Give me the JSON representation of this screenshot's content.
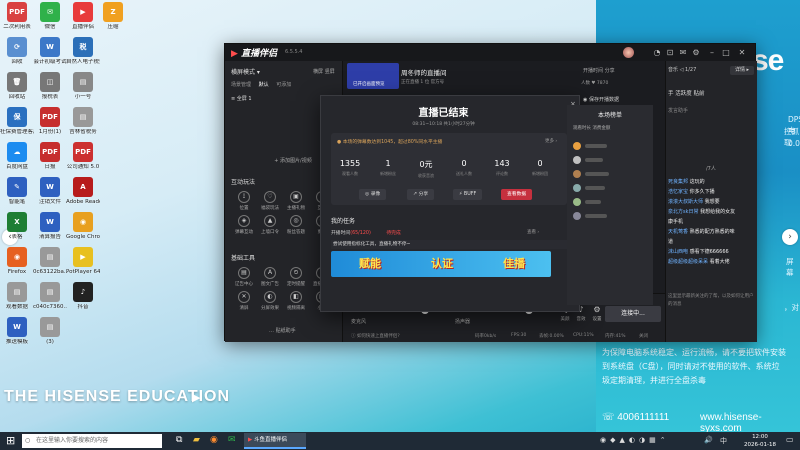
{
  "desktop": {
    "icons": [
      {
        "label": "二次利用表",
        "color": "#d94141",
        "glyph": "PDF"
      },
      {
        "label": "微信",
        "color": "#2fb14a",
        "glyph": "✉"
      },
      {
        "label": "直播伴侣",
        "color": "#e83b3b",
        "glyph": "▶"
      },
      {
        "label": "压缩",
        "color": "#f0a020",
        "glyph": "Z"
      },
      {
        "label": "回收",
        "color": "#5a8fd0",
        "glyph": "⟳"
      },
      {
        "label": "会计初级考试",
        "color": "#3c78c8",
        "glyph": "W"
      },
      {
        "label": "自然人电子税务局",
        "color": "#2b6fb8",
        "glyph": "税"
      },
      {
        "label": "回收站",
        "color": "#777777",
        "glyph": "🗑"
      },
      {
        "label": "报税表",
        "color": "#777777",
        "glyph": "◫"
      },
      {
        "label": "小一号",
        "color": "#888888",
        "glyph": "▤"
      },
      {
        "label": "社保费管理客户端",
        "color": "#2a70c0",
        "glyph": "保"
      },
      {
        "label": "1月份(1)",
        "color": "#c62e2e",
        "glyph": "PDF"
      },
      {
        "label": "吉林省税务",
        "color": "#999999",
        "glyph": "▤"
      },
      {
        "label": "百度网盘",
        "color": "#1c8cf0",
        "glyph": "☁"
      },
      {
        "label": "日报",
        "color": "#c62e2e",
        "glyph": "PDF"
      },
      {
        "label": "公司通知 5.0",
        "color": "#cc3030",
        "glyph": "PDF"
      },
      {
        "label": "智能笔",
        "color": "#2e60c0",
        "glyph": "✎"
      },
      {
        "label": "注销文件",
        "color": "#2e60c0",
        "glyph": "W"
      },
      {
        "label": "Adobe Reader XI",
        "color": "#b71c1c",
        "glyph": "A"
      },
      {
        "label": "表格",
        "color": "#1e7e34",
        "glyph": "X"
      },
      {
        "label": "清算报告",
        "color": "#2e60c0",
        "glyph": "W"
      },
      {
        "label": "Google Chrome",
        "color": "#e8a020",
        "glyph": "◉"
      },
      {
        "label": "Firefox",
        "color": "#e66020",
        "glyph": "◉"
      },
      {
        "label": "0c63122ba...",
        "color": "#999999",
        "glyph": "▤"
      },
      {
        "label": "PotPlayer 64 bit",
        "color": "#e8c020",
        "glyph": "▶"
      },
      {
        "label": "观看数据",
        "color": "#999999",
        "glyph": "▤"
      },
      {
        "label": "c040c7360...",
        "color": "#999999",
        "glyph": "▤"
      },
      {
        "label": "抖音",
        "color": "#222222",
        "glyph": "♪"
      },
      {
        "label": "推送模板",
        "color": "#2e60c0",
        "glyph": "W"
      },
      {
        "label": "(3)",
        "color": "#999999",
        "glyph": "▤"
      }
    ],
    "wallpaper": {
      "logo": "se",
      "brand": "THE HISENSE EDUCATION",
      "side_text": [
        "DPS电",
        "控抓取",
        "0.0",
        "屏幕",
        "，对"
      ],
      "notice": "为保障电脑系统稳定、运行流畅，请不要把软件安装到系统盘（C盘），同时请对不使用的软件、系统垃圾定期清理，并进行全盘杀毒",
      "hotline": "4006111111",
      "site": "www.hisense-syxs.com"
    }
  },
  "app": {
    "name": "直播伴侣",
    "version": "6.5.5.4",
    "titlebar_icons": [
      "bell-icon",
      "gift-icon",
      "mail-icon",
      "settings-icon",
      "minimize-icon",
      "maximize-icon",
      "close-icon"
    ],
    "left": {
      "mode": "横屏模式 ▾",
      "mode_actions": "横屏  竖屏",
      "scene_tabs": [
        "场景管理",
        "默认",
        "可添加"
      ],
      "scene_item": "全屏 1",
      "add_source": "+ 添加图片/视频",
      "section_interact": "互动玩法",
      "interact_tools": [
        {
          "icon": "⟟",
          "label": "位置"
        },
        {
          "icon": "♡",
          "label": "福袋玩法"
        },
        {
          "icon": "▣",
          "label": "主播礼物"
        },
        {
          "icon": "✦",
          "label": "互动"
        },
        {
          "icon": "◈",
          "label": "弹幕互动"
        },
        {
          "icon": "▲",
          "label": "上墙口令"
        },
        {
          "icon": "◎",
          "label": "粉丝答题"
        },
        {
          "icon": "✚",
          "label": "更多"
        }
      ],
      "section_basic": "基础工具",
      "basic_tools": [
        {
          "icon": "▤",
          "label": "辽告中心"
        },
        {
          "icon": "A",
          "label": "图文广告"
        },
        {
          "icon": "⏲",
          "label": "定时提醒"
        },
        {
          "icon": "≡",
          "label": "直播商品"
        },
        {
          "icon": "✕",
          "label": "清屏"
        },
        {
          "icon": "◐",
          "label": "分屏效果"
        },
        {
          "icon": "◧",
          "label": "视频隔离"
        },
        {
          "icon": "▥",
          "label": "小窗"
        }
      ],
      "helper": "… 贴纸助手"
    },
    "center": {
      "preview_tab": "已开启画面预览",
      "room_title": "周冬师的直播间",
      "room_sub": "正在直播  1 位  官方号",
      "room_stats": "开播时间  分享",
      "room_stats2": "人数 ♥ 7870",
      "audio": {
        "mic_label": "麦克风",
        "mic_pct": "100%",
        "speaker_label": "扬声器",
        "speaker_pct": "100%",
        "mic_level": 1.0,
        "speaker_level": 1.0,
        "buttons": [
          {
            "icon": "♫",
            "label": "美颜"
          },
          {
            "icon": "♪",
            "label": "音效"
          },
          {
            "icon": "⚙",
            "label": "设置"
          }
        ]
      },
      "connecting": "连接中...",
      "status": {
        "help": "如何快速上直播伴侣?",
        "rate": "码率0kb/s",
        "fps": "FPS:30",
        "drop": "丢帧:0.00%",
        "cpu": "CPU:11%",
        "mem": "内存:41%",
        "close": "关闭"
      }
    },
    "right": {
      "tabs": "音乐 ◁ 1/27",
      "detail": "详情 ▸",
      "line": "手  活跃度  贴前",
      "head": "发言助手",
      "num": "/7人",
      "messages": [
        {
          "user": "死良集邦",
          "text": "这玩的"
        },
        {
          "user": "浩忆家宝",
          "text": "你多久下播"
        },
        {
          "user": "滚滚大叔斯大师",
          "text": "我想要"
        },
        {
          "user": "泉北方sk日常",
          "text": "我想给我的女友"
        },
        {
          "user": "",
          "text": "康手机"
        },
        {
          "user": "天机莺香",
          "text": "熟悉的配方熟悉的味"
        },
        {
          "user": "",
          "text": "道"
        },
        {
          "user": "沫山西咆",
          "text": "感看下德666666"
        },
        {
          "user": "超级超级超级呆呆",
          "text": "看着大佬"
        }
      ],
      "tip": "这里显示最新关注的了帮，以及如何让用户的消息"
    }
  },
  "ended_dialog": {
    "title": "直播已结束",
    "time": "08:31~10:18 共1小时27分钟",
    "close": "×",
    "summary_note": "本场的弹幕数达到1045，超过80%同水平主播",
    "summary_more": "更多 ›",
    "stats": [
      {
        "value": "1355",
        "label": "观看人数"
      },
      {
        "value": "1",
        "label": "新增粉丝"
      },
      {
        "value": "0元",
        "label": "收获音浪"
      },
      {
        "value": "0",
        "label": "送礼人数"
      },
      {
        "value": "143",
        "label": "评论数"
      },
      {
        "value": "0",
        "label": "新增粉团"
      }
    ],
    "buttons": [
      {
        "icon": "◎",
        "label": "录像"
      },
      {
        "icon": "↗",
        "label": "分享"
      },
      {
        "icon": "⚡",
        "label": "BUFF"
      },
      {
        "icon": "",
        "label": "查看数据"
      }
    ],
    "tasks_title": "我的任务",
    "tasks_row_prefix": "开播时间",
    "tasks_row_highlight": "(65/120)",
    "tasks_row_suffix": "待完成",
    "tasks_more": "查看 ›",
    "task_banner": "尝试使用指标化工具，直播礼物不停~",
    "banner_words": [
      "赋能",
      "认证",
      "佳播"
    ],
    "right_title": "本场榜单",
    "right_tabs": "观看时长    消费金额",
    "preview_btn": "保存开播数据"
  },
  "taskbar": {
    "search_placeholder": "在这里输入你要搜索的内容",
    "time": "12:00",
    "date": "2026-01-18",
    "lang": "中",
    "app_active": "斗鱼直播伴侣"
  }
}
